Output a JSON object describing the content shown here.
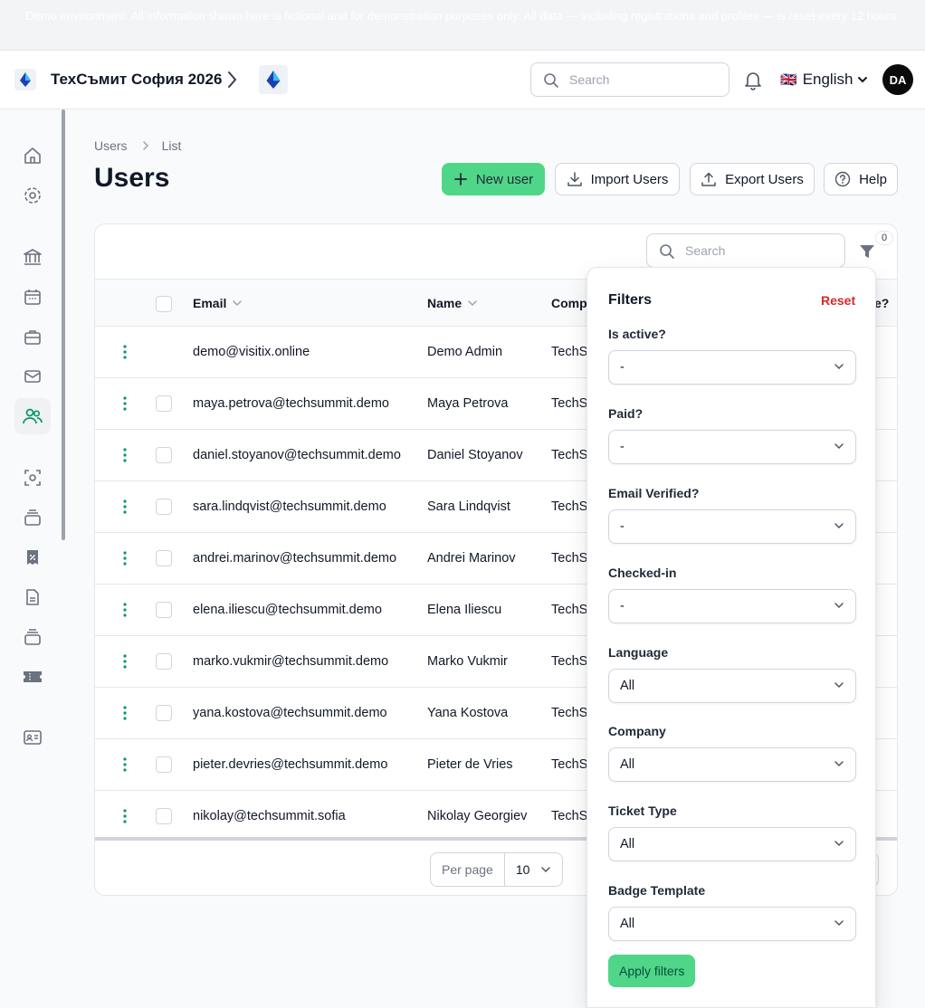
{
  "banner": {
    "text": "Demo environment. All information shown here is fictional and for demonstration purposes only. All data — including registrations and profiles — is reset every 12 hours."
  },
  "header": {
    "tenant_name": "ТехСъмит София 2026",
    "search_placeholder": "Search",
    "language_flag": "🇬🇧",
    "language_label": "English",
    "avatar_initials": "DA"
  },
  "sidebar": {
    "items": [
      {
        "icon": "home-icon"
      },
      {
        "icon": "gear-icon"
      },
      {
        "icon": "bank-icon"
      },
      {
        "icon": "calendar-icon"
      },
      {
        "icon": "briefcase-icon"
      },
      {
        "icon": "mail-icon"
      },
      {
        "icon": "users-icon",
        "active": true
      },
      {
        "icon": "scan-icon"
      },
      {
        "icon": "stack-icon"
      },
      {
        "icon": "receipt-percent-icon"
      },
      {
        "icon": "document-icon"
      },
      {
        "icon": "stack-icon"
      },
      {
        "icon": "ticket-icon"
      },
      {
        "icon": "id-card-icon"
      }
    ]
  },
  "breadcrumb": {
    "parent": "Users",
    "current": "List"
  },
  "page": {
    "title": "Users"
  },
  "actions": {
    "new_user": "New user",
    "import_users": "Import Users",
    "export_users": "Export Users",
    "help": "Help"
  },
  "table": {
    "search_placeholder": "Search",
    "filter_count": "0",
    "columns": {
      "email": "Email",
      "name": "Name",
      "company": "Comp",
      "last_partial": "e?"
    },
    "rows": [
      {
        "email": "demo@visitix.online",
        "name": "Demo Admin",
        "company": "TechS"
      },
      {
        "email": "maya.petrova@techsummit.demo",
        "name": "Maya Petrova",
        "company": "TechS"
      },
      {
        "email": "daniel.stoyanov@techsummit.demo",
        "name": "Daniel Stoyanov",
        "company": "TechS"
      },
      {
        "email": "sara.lindqvist@techsummit.demo",
        "name": "Sara Lindqvist",
        "company": "TechS"
      },
      {
        "email": "andrei.marinov@techsummit.demo",
        "name": "Andrei Marinov",
        "company": "TechS"
      },
      {
        "email": "elena.iliescu@techsummit.demo",
        "name": "Elena Iliescu",
        "company": "TechS"
      },
      {
        "email": "marko.vukmir@techsummit.demo",
        "name": "Marko Vukmir",
        "company": "TechS"
      },
      {
        "email": "yana.kostova@techsummit.demo",
        "name": "Yana Kostova",
        "company": "TechS"
      },
      {
        "email": "pieter.devries@techsummit.demo",
        "name": "Pieter de Vries",
        "company": "TechS"
      },
      {
        "email": "nikolay@techsummit.sofia",
        "name": "Nikolay Georgiev",
        "company": "TechS"
      }
    ],
    "per_page_label": "Per page",
    "per_page_value": "10"
  },
  "filters": {
    "title": "Filters",
    "reset": "Reset",
    "fields": [
      {
        "label": "Is active?",
        "value": "-"
      },
      {
        "label": "Paid?",
        "value": "-"
      },
      {
        "label": "Email Verified?",
        "value": "-"
      },
      {
        "label": "Checked-in",
        "value": "-"
      },
      {
        "label": "Language",
        "value": "All"
      },
      {
        "label": "Company",
        "value": "All"
      },
      {
        "label": "Ticket Type",
        "value": "All"
      },
      {
        "label": "Badge Template",
        "value": "All"
      }
    ],
    "apply": "Apply filters"
  },
  "colors": {
    "primary_green": "#4fd688",
    "active_nav_icon": "#059669",
    "kebab_green": "#059669",
    "reset_red": "#dc2626",
    "avatar_bg": "#0b0b0b"
  }
}
